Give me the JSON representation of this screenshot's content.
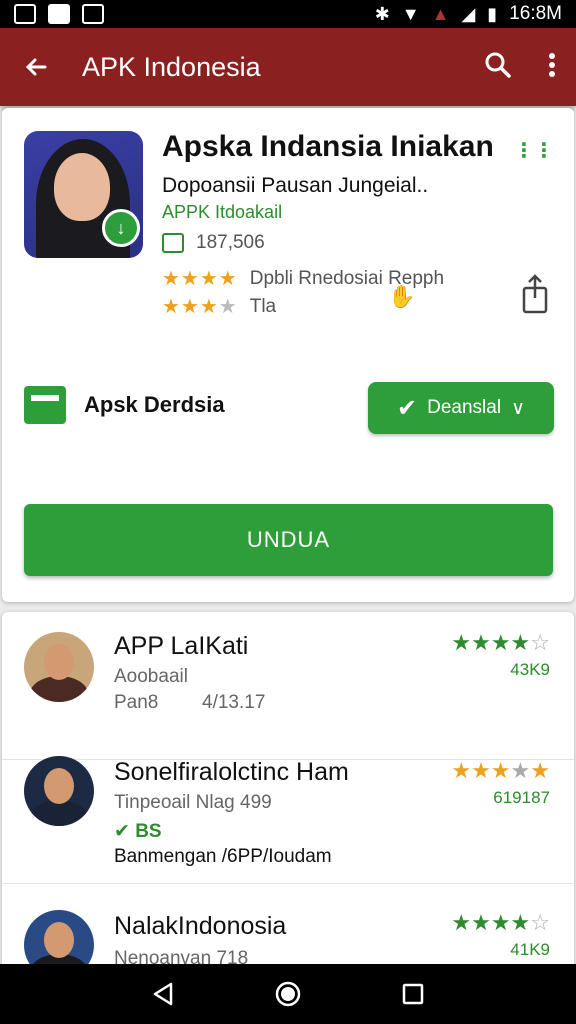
{
  "status_bar": {
    "time": "16:8M"
  },
  "app_bar": {
    "title": "APK Indonesia"
  },
  "app": {
    "name": "Apska Indansia Iniakan",
    "subtitle": "Dopoansii Pausan Jungeial..",
    "developer": "APPK Itdoakail",
    "size": "187,506",
    "rating_line1": "Dpbli Rnedosiai Repph",
    "rating_line1_stars": 4,
    "rating_line2": "Tla",
    "rating_line2_stars": 3
  },
  "storage": {
    "label": "Apsk Derdsia"
  },
  "secondary_button": {
    "label": "Deanslal",
    "arrow": "∨"
  },
  "primary_button": {
    "label": "UNDUA"
  },
  "list": [
    {
      "title": "APP LaIKati",
      "line1": "Aoobaail",
      "line2a": "Pan8",
      "line2b": "4/13.17",
      "stars": 4,
      "stars_color": "green",
      "count": "43K9"
    },
    {
      "title": "Sonelfiralolctinc Ham",
      "line1": "Tinpeoail Nlag 499",
      "badge": "BS",
      "line3": "Banmengan /6PP/Ioudam",
      "stars": 3,
      "stars_color": "orange",
      "count": "619187"
    },
    {
      "title": "NalakIndonosia",
      "line1": "Nenoanvan 718",
      "stars": 4,
      "stars_color": "green",
      "count": "41K9"
    }
  ],
  "icons": {
    "back": "arrow-left-icon",
    "search": "search-icon",
    "more": "more-vert-icon"
  }
}
